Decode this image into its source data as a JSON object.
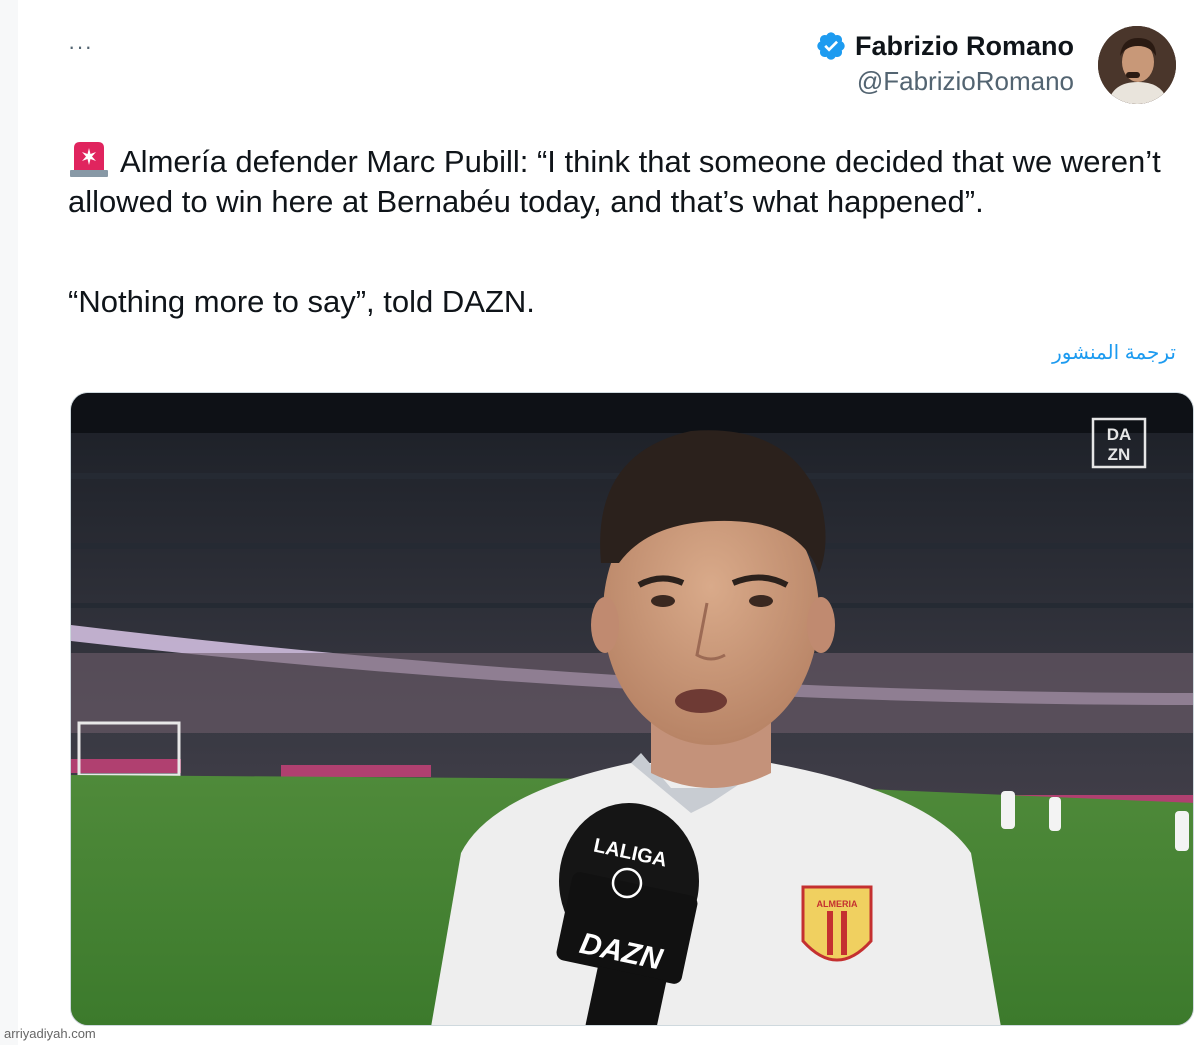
{
  "author": {
    "display_name": "Fabrizio Romano",
    "handle": "@FabrizioRomano",
    "verified": true
  },
  "more_menu": "···",
  "tweet": {
    "siren_icon": "rotating-light-icon",
    "line1": "Almería defender Marc Pubill: “I think that someone decided that we weren’t allowed to win here at Bernabéu today, and that’s what happened”.",
    "line2": "“Nothing more to say”, told DAZN."
  },
  "translate_link": "ترجمة المنشور",
  "media": {
    "broadcaster_logo_line1": "DA",
    "broadcaster_logo_line2": "ZN",
    "mic_top": "LALIGA",
    "mic_brand": "DAZN",
    "crest_text": "ALMERIA"
  },
  "watermark": "arriyadiyah.com",
  "colors": {
    "accent": "#1d9bf0",
    "text": "#0f1419",
    "secondary": "#536471"
  }
}
